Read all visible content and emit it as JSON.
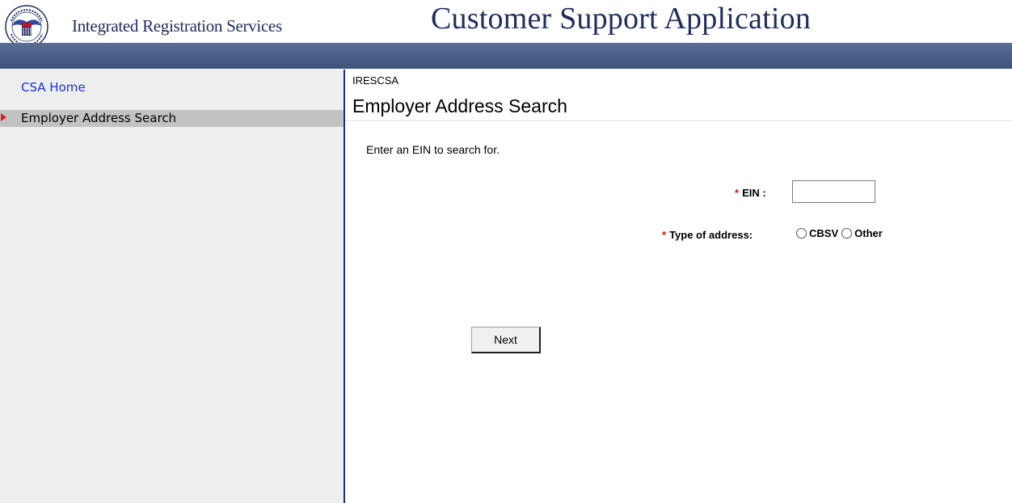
{
  "header": {
    "org_name": "Integrated Registration Services",
    "app_title": "Customer Support Application",
    "logo_icon": "ssa-seal-icon",
    "band_color": "#4b6088"
  },
  "sidebar": {
    "items": [
      {
        "label": "CSA Home",
        "current": false
      },
      {
        "label": "Employer Address Search",
        "current": true
      }
    ]
  },
  "main": {
    "app_code": "IRESCSA",
    "page_title": "Employer Address Search",
    "instruction": "Enter an EIN to search for.",
    "required_marker": "*",
    "ein": {
      "label": "EIN :",
      "value": ""
    },
    "address_type": {
      "label": "Type of address:",
      "options": [
        "CBSV",
        "Other"
      ],
      "selected": null
    },
    "next_label": "Next"
  },
  "colors": {
    "title_text": "#1f2d5c",
    "link": "#1a33d6",
    "required": "#d01010",
    "sidebar_bg": "#eeeeee",
    "current_item_bg": "#c2c2c2"
  }
}
